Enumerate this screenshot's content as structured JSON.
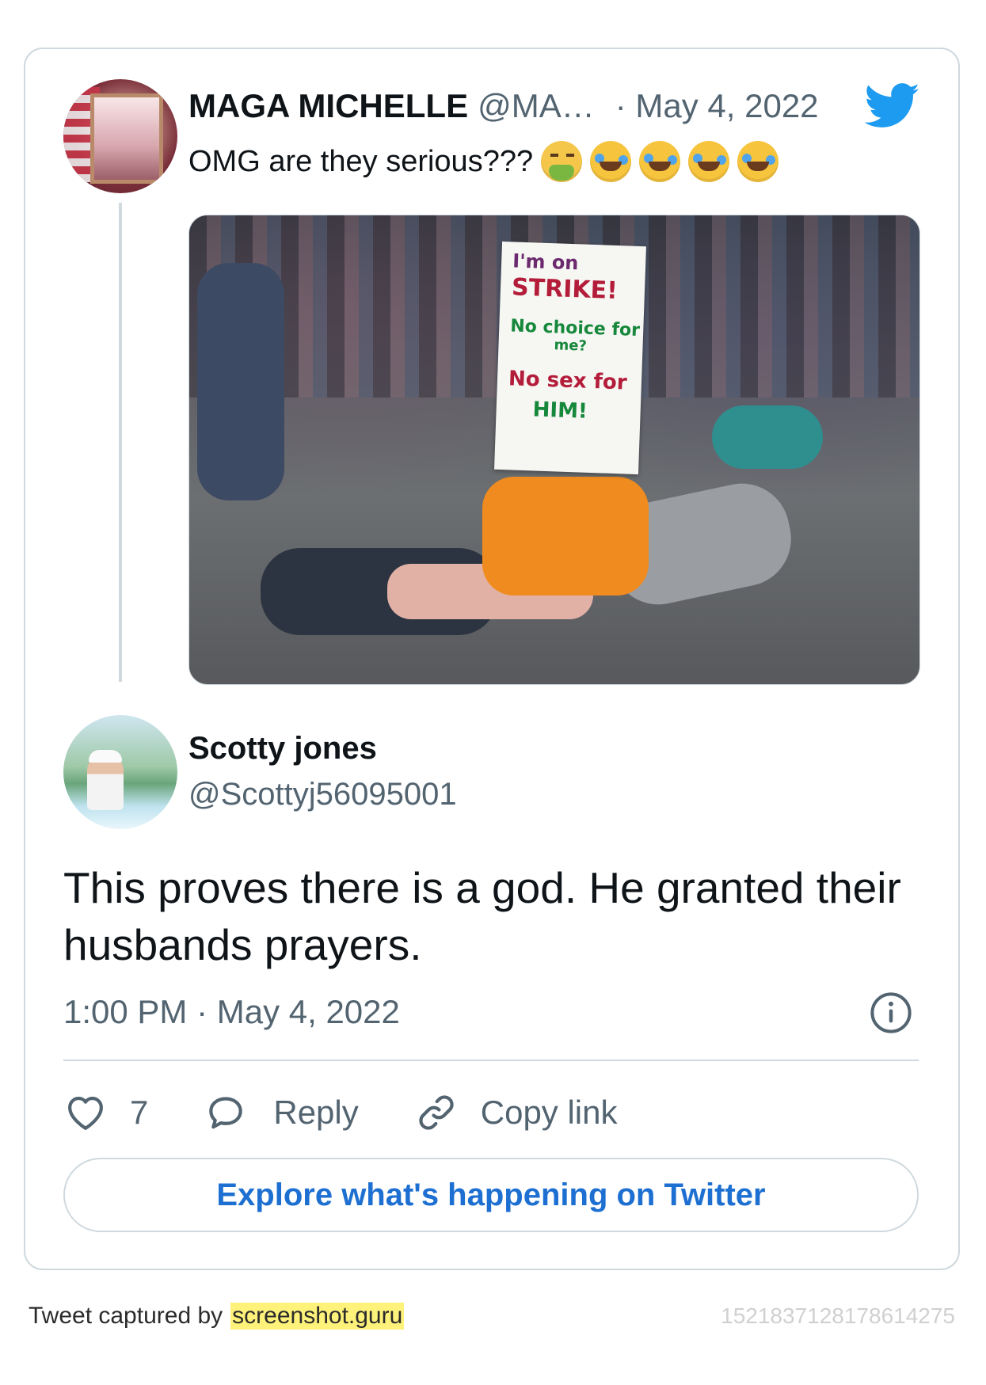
{
  "quoted_tweet": {
    "author_name": "MAGA MICHELLE",
    "author_handle": "@MA…",
    "date": "· May 4, 2022",
    "text": "OMG are they serious???",
    "emojis": [
      "face-vomiting",
      "rolling-on-the-floor-laughing",
      "rolling-on-the-floor-laughing",
      "rolling-on-the-floor-laughing",
      "rolling-on-the-floor-laughing"
    ],
    "photo": {
      "sign_lines": [
        "I'm on",
        "STRIKE!",
        "No choice for",
        "me?",
        "No sex for",
        "HIM!"
      ]
    }
  },
  "tweet": {
    "author_name": "Scotty jones",
    "author_handle": "@Scottyj56095001",
    "text": "This proves there is a god. He granted their husbands prayers.",
    "timestamp": "1:00 PM · May 4, 2022"
  },
  "actions": {
    "like_count": "7",
    "reply_label": "Reply",
    "copy_label": "Copy link"
  },
  "explore_label": "Explore what's happening on Twitter",
  "footer": {
    "prefix": "Tweet captured by",
    "brand": "screenshot.guru",
    "tweet_id": "1521837128178614275"
  },
  "colors": {
    "twitter_blue": "#1d9bf0",
    "link_blue": "#1d6fd1",
    "muted_text": "#536471",
    "border": "#cfd9de",
    "highlight": "#fff27a"
  }
}
